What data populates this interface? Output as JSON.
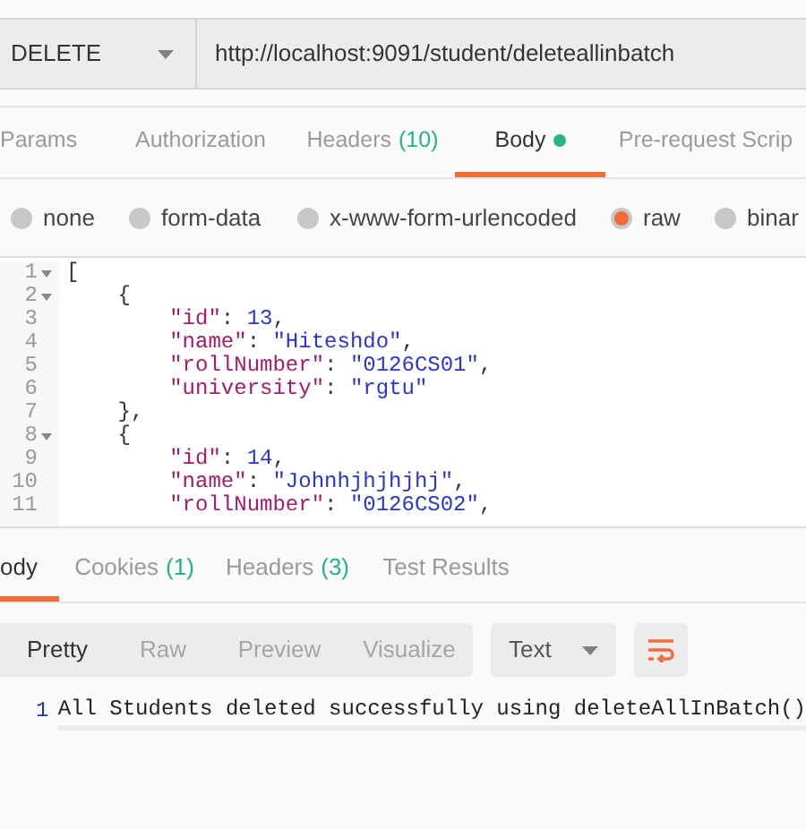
{
  "request": {
    "method": "DELETE",
    "url": "http://localhost:9091/student/deleteallinbatch"
  },
  "request_tabs": [
    {
      "label": "Params",
      "selected": false
    },
    {
      "label": "Authorization",
      "selected": false
    },
    {
      "label": "Headers",
      "count": "(10)",
      "selected": false
    },
    {
      "label": "Body",
      "selected": true,
      "has_content": true
    },
    {
      "label": "Pre-request Scrip",
      "selected": false
    }
  ],
  "body_modes": [
    {
      "label": "none",
      "selected": false
    },
    {
      "label": "form-data",
      "selected": false
    },
    {
      "label": "x-www-form-urlencoded",
      "selected": false
    },
    {
      "label": "raw",
      "selected": true
    },
    {
      "label": "binar",
      "selected": false
    }
  ],
  "editor_lines": [
    {
      "number": "1",
      "foldable": true,
      "tokens": [
        {
          "kind": "punct",
          "text": "["
        }
      ]
    },
    {
      "number": "2",
      "foldable": true,
      "tokens": [
        {
          "kind": "punct",
          "text": "    {"
        }
      ]
    },
    {
      "number": "3",
      "foldable": false,
      "tokens": [
        {
          "kind": "key",
          "text": "        \"id\""
        },
        {
          "kind": "punct",
          "text": ": "
        },
        {
          "kind": "number",
          "text": "13"
        },
        {
          "kind": "punct",
          "text": ","
        }
      ]
    },
    {
      "number": "4",
      "foldable": false,
      "tokens": [
        {
          "kind": "key",
          "text": "        \"name\""
        },
        {
          "kind": "punct",
          "text": ": "
        },
        {
          "kind": "string",
          "text": "\"Hiteshdo\""
        },
        {
          "kind": "punct",
          "text": ","
        }
      ]
    },
    {
      "number": "5",
      "foldable": false,
      "tokens": [
        {
          "kind": "key",
          "text": "        \"rollNumber\""
        },
        {
          "kind": "punct",
          "text": ": "
        },
        {
          "kind": "string",
          "text": "\"0126CS01\""
        },
        {
          "kind": "punct",
          "text": ","
        }
      ]
    },
    {
      "number": "6",
      "foldable": false,
      "tokens": [
        {
          "kind": "key",
          "text": "        \"university\""
        },
        {
          "kind": "punct",
          "text": ": "
        },
        {
          "kind": "string",
          "text": "\"rgtu\""
        }
      ]
    },
    {
      "number": "7",
      "foldable": false,
      "tokens": [
        {
          "kind": "punct",
          "text": "    },"
        }
      ]
    },
    {
      "number": "8",
      "foldable": true,
      "tokens": [
        {
          "kind": "punct",
          "text": "    {"
        }
      ]
    },
    {
      "number": "9",
      "foldable": false,
      "tokens": [
        {
          "kind": "key",
          "text": "        \"id\""
        },
        {
          "kind": "punct",
          "text": ": "
        },
        {
          "kind": "number",
          "text": "14"
        },
        {
          "kind": "punct",
          "text": ","
        }
      ]
    },
    {
      "number": "10",
      "foldable": false,
      "tokens": [
        {
          "kind": "key",
          "text": "        \"name\""
        },
        {
          "kind": "punct",
          "text": ": "
        },
        {
          "kind": "string",
          "text": "\"Johnhjhjhjhj\""
        },
        {
          "kind": "punct",
          "text": ","
        }
      ]
    },
    {
      "number": "11",
      "foldable": false,
      "tokens": [
        {
          "kind": "key",
          "text": "        \"rollNumber\""
        },
        {
          "kind": "punct",
          "text": ": "
        },
        {
          "kind": "string",
          "text": "\"0126CS02\""
        },
        {
          "kind": "punct",
          "text": ","
        }
      ]
    }
  ],
  "response_tabs": [
    {
      "label": "ody",
      "selected": true
    },
    {
      "label": "Cookies",
      "count": "(1)",
      "selected": false
    },
    {
      "label": "Headers",
      "count": "(3)",
      "selected": false
    },
    {
      "label": "Test Results",
      "selected": false
    }
  ],
  "view_modes": [
    {
      "label": "Pretty",
      "selected": true
    },
    {
      "label": "Raw",
      "selected": false
    },
    {
      "label": "Preview",
      "selected": false
    },
    {
      "label": "Visualize",
      "selected": false
    }
  ],
  "format": "Text",
  "output_lines": [
    {
      "number": "1",
      "text": "All Students deleted successfully using deleteAllInBatch()"
    }
  ]
}
